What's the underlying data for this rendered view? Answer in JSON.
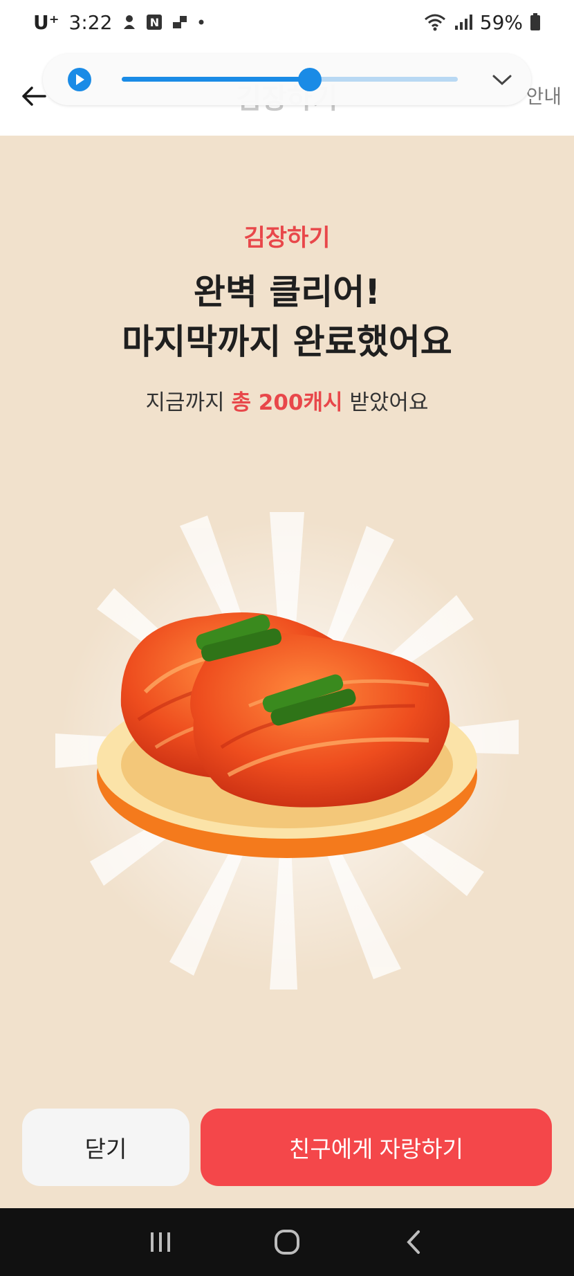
{
  "status_bar": {
    "carrier": "U⁺",
    "time": "3:22",
    "battery": "59%",
    "icons": [
      "character-icon",
      "n-app-icon",
      "photo-icon",
      "dot-icon",
      "wifi-icon",
      "signal-icon",
      "battery-icon"
    ],
    "n_badge": "N"
  },
  "header": {
    "title": "김장하기",
    "guide_label": "안내"
  },
  "media_player": {
    "progress": 0.56
  },
  "content": {
    "kicker": "김장하기",
    "headline_line1": "완벽 클리어!",
    "headline_line2": "마지막까지 완료했어요",
    "summary_prefix": "지금까지 ",
    "summary_highlight": "총 200캐시",
    "summary_suffix": " 받았어요",
    "illustration": "kimchi-plate-illustration"
  },
  "buttons": {
    "close_label": "닫기",
    "share_label": "친구에게 자랑하기"
  },
  "colors": {
    "accent": "#f4474a",
    "background": "#f1e1cc",
    "player_blue": "#1a8be6"
  }
}
